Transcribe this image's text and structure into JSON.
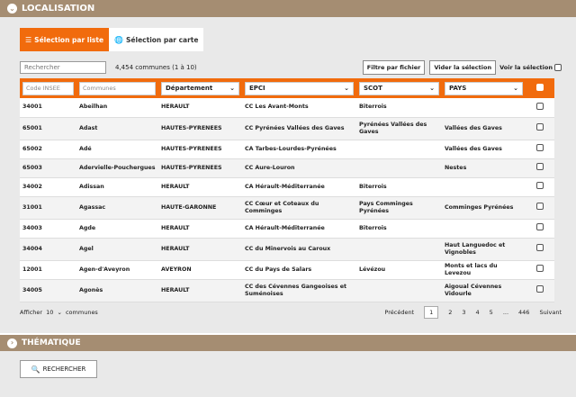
{
  "header": {
    "title": "LOCALISATION",
    "icon": "chevron-down-icon"
  },
  "tabs": [
    {
      "label": "Sélection par liste",
      "icon": "list-icon",
      "active": true
    },
    {
      "label": "Sélection par carte",
      "icon": "globe-icon",
      "active": false
    }
  ],
  "toolbar": {
    "search_placeholder": "Rechercher",
    "count": "4,454 communes (1 à 10)",
    "filter_file": "Filtre par fichier",
    "clear_selection": "Vider la sélection",
    "show_selection": "Voir la sélection"
  },
  "table": {
    "headers": {
      "insee_placeholder": "Code INSEE",
      "communes_placeholder": "Communes",
      "departement": "Département",
      "epci": "EPCI",
      "scot": "SCOT",
      "pays": "PAYS"
    },
    "rows": [
      {
        "code": "34001",
        "commune": "Abeilhan",
        "dept": "HERAULT",
        "epci": "CC Les Avant-Monts",
        "scot": "Biterrois",
        "pays": ""
      },
      {
        "code": "65001",
        "commune": "Adast",
        "dept": "HAUTES-PYRENEES",
        "epci": "CC Pyrénées Vallées des Gaves",
        "scot": "Pyrénées Vallées des Gaves",
        "pays": "Vallées des Gaves"
      },
      {
        "code": "65002",
        "commune": "Adé",
        "dept": "HAUTES-PYRENEES",
        "epci": "CA Tarbes-Lourdes-Pyrénées",
        "scot": "",
        "pays": "Vallées des Gaves"
      },
      {
        "code": "65003",
        "commune": "Adervielle-Pouchergues",
        "dept": "HAUTES-PYRENEES",
        "epci": "CC Aure-Louron",
        "scot": "",
        "pays": "Nestes"
      },
      {
        "code": "34002",
        "commune": "Adissan",
        "dept": "HERAULT",
        "epci": "CA Hérault-Méditerranée",
        "scot": "Biterrois",
        "pays": ""
      },
      {
        "code": "31001",
        "commune": "Agassac",
        "dept": "HAUTE-GARONNE",
        "epci": "CC Cœur et Coteaux du Comminges",
        "scot": "Pays Comminges Pyrénées",
        "pays": "Comminges Pyrénées"
      },
      {
        "code": "34003",
        "commune": "Agde",
        "dept": "HERAULT",
        "epci": "CA Hérault-Méditerranée",
        "scot": "Biterrois",
        "pays": ""
      },
      {
        "code": "34004",
        "commune": "Agel",
        "dept": "HERAULT",
        "epci": "CC du Minervois au Caroux",
        "scot": "",
        "pays": "Haut Languedoc et Vignobles"
      },
      {
        "code": "12001",
        "commune": "Agen-d'Aveyron",
        "dept": "AVEYRON",
        "epci": "CC du Pays de Salars",
        "scot": "Lévézou",
        "pays": "Monts et lacs du Levezou"
      },
      {
        "code": "34005",
        "commune": "Agonès",
        "dept": "HERAULT",
        "epci": "CC des Cévennes Gangeoises et Suménoises",
        "scot": "",
        "pays": "Aigoual Cévennes Vidourle"
      }
    ]
  },
  "pager": {
    "show": "Afficher",
    "per_page": "10",
    "unit": "communes",
    "prev": "Précédent",
    "pages": [
      "1",
      "2",
      "3",
      "4",
      "5",
      "...",
      "446"
    ],
    "current": "1",
    "next": "Suivant"
  },
  "thematique": {
    "title": "THÉMATIQUE",
    "icon": "chevron-right-icon"
  },
  "search_button": {
    "label": "RECHERCHER",
    "icon": "search-icon"
  },
  "colors": {
    "accent": "#f16b0d",
    "header_bg": "#a58d72",
    "panel_bg": "#e9e9e9"
  }
}
